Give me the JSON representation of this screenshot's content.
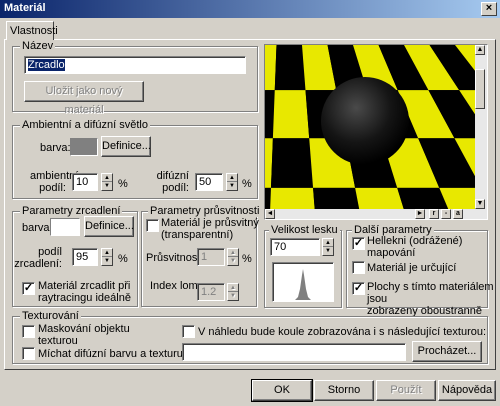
{
  "window": {
    "title": "Materiál"
  },
  "tabs": [
    {
      "label": "Vlastnosti"
    }
  ],
  "name_group": {
    "legend": "Název",
    "name_value": "Zrcadlo",
    "save_button": "Uložit jako nový materiál"
  },
  "ambient_group": {
    "legend": "Ambientní a difúzní světlo",
    "color_label": "barva:",
    "color_value": "#808080",
    "define_button": "Definice...",
    "ambient_label_line1": "ambientní",
    "ambient_label_line2": "podíl:",
    "ambient_value": "10",
    "ambient_unit": "%",
    "diffuse_label_line1": "difúzní",
    "diffuse_label_line2": "podíl:",
    "diffuse_value": "50",
    "diffuse_unit": "%"
  },
  "mirror_group": {
    "legend": "Parametry zrcadlení",
    "color_label": "barva:",
    "color_value": "#ffffff",
    "define_button": "Definice...",
    "share_label_line1": "podíl",
    "share_label_line2": "zrcadlení:",
    "share_value": "95",
    "share_unit": "%",
    "raytrace_checkbox_line1": "Materiál zrcadlit při",
    "raytrace_checkbox_line2": "raytracingu ideálně",
    "raytrace_checked": true
  },
  "transparency_group": {
    "legend": "Parametry průsvitnosti",
    "transparent_checkbox_line1": "Materiál je průsvitný",
    "transparent_checkbox_line2": "(transparentní)",
    "transparent_checked": false,
    "transparency_label": "Průsvitnost:",
    "transparency_value": "1",
    "transparency_unit": "%",
    "refraction_label": "Index lomu:",
    "refraction_value": "1.2"
  },
  "preview": {
    "checker_color_1": "#e8e800",
    "checker_color_2": "#000000",
    "buttons": [
      "r",
      "-",
      "a"
    ]
  },
  "highlight_group": {
    "legend": "Velikost lesku",
    "value": "70"
  },
  "other_group": {
    "legend": "Další parametry",
    "reflected_line1": "Hellekni (odrážené)",
    "reflected_line2": "mapování",
    "reflected_checked": true,
    "defining_label": "Materiál je určující",
    "defining_checked": false,
    "twosided_line1": "Plochy s tímto materiálem jsou",
    "twosided_line2": "zobrazeny oboustranně",
    "twosided_checked": true
  },
  "texture_group": {
    "legend": "Texturování",
    "mask_line1": "Maskování objektu",
    "mask_line2": "texturou",
    "mask_checked": false,
    "mix_label": "Míchat difúzní barvu a texturu",
    "mix_checked": false,
    "preview_texture_label": "V náhledu bude koule zobrazována i s následující texturou:",
    "preview_texture_checked": false,
    "texture_path": "",
    "browse_button": "Procházet..."
  },
  "footer": {
    "ok": "OK",
    "cancel": "Storno",
    "apply": "Použít",
    "help": "Nápověda"
  }
}
